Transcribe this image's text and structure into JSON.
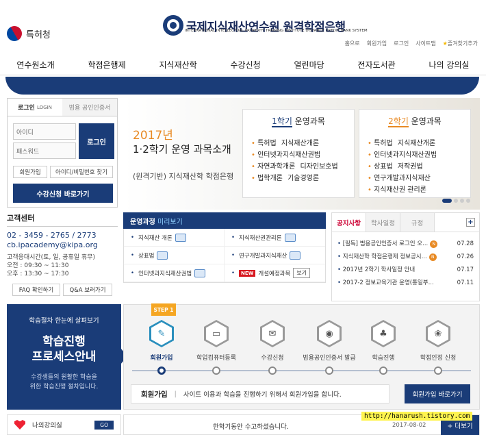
{
  "header": {
    "agency": "특허청",
    "logo_title": "국제지식재산연수원 원격학점은행",
    "logo_sub": "INTERNATIONAL INTELLECTUAL PROPERTY TRAINING INSTITUTE DISTANCE CREDIT BANK SYSTEM",
    "util": [
      "홈으로",
      "회원가입",
      "로그인",
      "사이트맵",
      "즐겨찾기추가"
    ]
  },
  "gnb": [
    "연수원소개",
    "학점은행제",
    "지식재산학",
    "수강신청",
    "열린마당",
    "전자도서관",
    "나의 강의실"
  ],
  "login": {
    "tab_login": "로그인",
    "tab_login_en": "LOGIN",
    "tab_cert": "범용 공인인증서",
    "id_placeholder": "아이디",
    "pw_placeholder": "패스워드",
    "login_btn": "로그인",
    "join_btn": "회원가입",
    "find_btn": "아이디/비밀번호 찾기",
    "course_btn": "수강신청 바로가기"
  },
  "banner": {
    "year": "2017년",
    "title": "1·2학기 운영 과목소개",
    "sub": "(원격기반) 지식재산학 학점은행",
    "card1_num": "1학기",
    "card1_rest": " 운영과목",
    "card1_items": [
      "특허법",
      "지식재산개론",
      "인터넷과지식재산권법",
      "자연과학개론",
      "디자인보호법",
      "법학개론",
      "기술경영론"
    ],
    "card2_num": "2학기",
    "card2_rest": " 운영과목",
    "card2_items": [
      "특허법",
      "지식재산개론",
      "인터넷과지식재산권법",
      "상표법",
      "저작권법",
      "연구개발과지식재산",
      "지식재산권 관리론"
    ]
  },
  "customer": {
    "title": "고객센터",
    "tel": "02 - 3459 - 2765 / 2773",
    "email": "cb.ipacademy@kipa.org",
    "hours_label": "고객응대시간(토, 일, 공휴일 휴무)",
    "am": "오전 : 09:30 ~ 11:30",
    "pm": "오후 : 13:30 ~ 17:30",
    "faq_btn": "FAQ 확인하기",
    "qa_btn": "Q&A 보러가기"
  },
  "preview": {
    "title_a": "운영과정",
    "title_b": "미리보기",
    "items": [
      "지식재산 개론",
      "지식재산권관리론",
      "상표법",
      "연구개발과지식재산",
      "인터넷과지식재산권법",
      "개설예정과목"
    ],
    "new_badge": "NEW",
    "view_btn": "보기"
  },
  "notice": {
    "tabs": [
      "공지사항",
      "학사일정",
      "규정"
    ],
    "plus": "+",
    "items": [
      {
        "title": "[필독] 범용공인인증서 로그인 오...",
        "new": "N",
        "date": "07.28"
      },
      {
        "title": "지식재산학 학점은행제 정보공시...",
        "new": "N",
        "date": "07.26"
      },
      {
        "title": "2017년 2학기 학사일정 안내",
        "new": "",
        "date": "07.17"
      },
      {
        "title": "2017-2 정보교육기관 운영(통일부...",
        "new": "",
        "date": "07.11"
      }
    ]
  },
  "process": {
    "intro": "학습절차 한눈에 살펴보기",
    "title1": "학습진행",
    "title2": "프로세스안내",
    "desc1": "수강생들의 원활한 학습을",
    "desc2": "위한 학습진행 절차입니다.",
    "step_badge": "STEP 1",
    "steps": [
      "회원가입",
      "학업컴퓨터등록",
      "수강신청",
      "범용공인인증서 발급",
      "학습진행",
      "학점인정 신청"
    ],
    "step_icons": [
      "✎",
      "▭",
      "✉",
      "◉",
      "♣",
      "❀"
    ],
    "box_title": "회원가입",
    "box_text": "사이트 이용과 학습을 진행하기 위해서 회원가입을 합니다.",
    "box_btn": "회원가입 바로가기"
  },
  "bottom": {
    "my_class": "나의강의실",
    "go": "GO",
    "msg": "한학기동안 수고하셨습니다.",
    "date": "2017-08-02",
    "more": "+ 더보기"
  },
  "watermark": "http://hanarush.tistory.com"
}
